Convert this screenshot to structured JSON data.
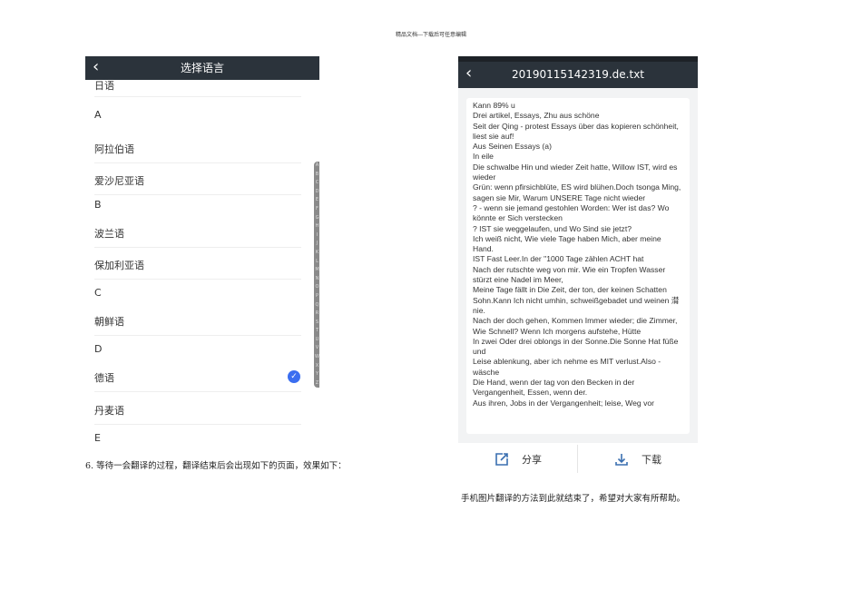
{
  "doc_header": "精品文档---下载后可任意编辑",
  "left_screen": {
    "title": "选择语言",
    "rows": [
      {
        "type": "item",
        "label": "日语"
      },
      {
        "type": "section",
        "label": "A"
      },
      {
        "type": "item",
        "label": "阿拉伯语"
      },
      {
        "type": "item",
        "label": "爱沙尼亚语"
      },
      {
        "type": "section",
        "label": "B"
      },
      {
        "type": "item",
        "label": "波兰语"
      },
      {
        "type": "item",
        "label": "保加利亚语"
      },
      {
        "type": "section",
        "label": "C"
      },
      {
        "type": "item",
        "label": "朝鲜语"
      },
      {
        "type": "section",
        "label": "D"
      },
      {
        "type": "item",
        "label": "德语",
        "selected": true
      },
      {
        "type": "item",
        "label": "丹麦语"
      },
      {
        "type": "section",
        "label": "E"
      }
    ],
    "index_letters": [
      "A",
      "B",
      "C",
      "D",
      "E",
      "F",
      "G",
      "H",
      "I",
      "J",
      "K",
      "L",
      "M",
      "N",
      "O",
      "P",
      "Q",
      "R",
      "S",
      "T",
      "U",
      "V",
      "W",
      "X",
      "Y",
      "Z"
    ],
    "accent": "#3b6ef0"
  },
  "caption1": "6. 等待一会翻译的过程，翻译结束后会出现如下的页面，效果如下：",
  "right_screen": {
    "title": "20190115142319.de.txt",
    "text": "Kann 89% u\nDrei artikel, Essays, Zhu aus schöne\nSeit der Qing - protest Essays über das kopieren schönheit, liest sie auf!\nAus Seinen Essays (a)\nIn eile\nDie schwalbe Hin und wieder Zeit hatte, Willow IST, wird es wieder\nGrün: wenn pfirsichblüte, ES wird blühen.Doch tsonga Ming, sagen sie Mir, Warum UNSERE Tage nicht wieder\n? - wenn sie jemand gestohlen Worden: Wer ist das? Wo könnte er Sich verstecken\n? IST sie weggelaufen, und Wo Sind sie jetzt?\nIch weiß nicht, Wie viele Tage haben Mich, aber meine Hand.\nIST Fast Leer.In der \"1000 Tage zählen ACHT hat\nNach der rutschte weg von mir. Wie ein Tropfen Wasser stürzt eine Nadel im Meer,\nMeine Tage fällt in Die Zeit, der ton, der keinen Schatten\nSohn.Kann Ich nicht umhin, schweißgebadet und weinen 潸 nie.\nNach der doch gehen, Kommen Immer wieder; die Zimmer, Wie Schnell? Wenn Ich morgens aufstehe, Hütte\nIn zwei Oder drei oblongs in der Sonne.Die Sonne Hat füße und\nLeise ablenkung, aber ich nehme es MIT verlust.Also - wäsche\nDie Hand, wenn der tag von den Becken in der Vergangenheit, Essen, wenn der.\nAus ihren, Jobs in der Vergangenheit; leise, Weg vor",
    "share_label": "分享",
    "download_label": "下载"
  },
  "caption2": "手机图片翻译的方法到此就结束了，希望对大家有所帮助。"
}
